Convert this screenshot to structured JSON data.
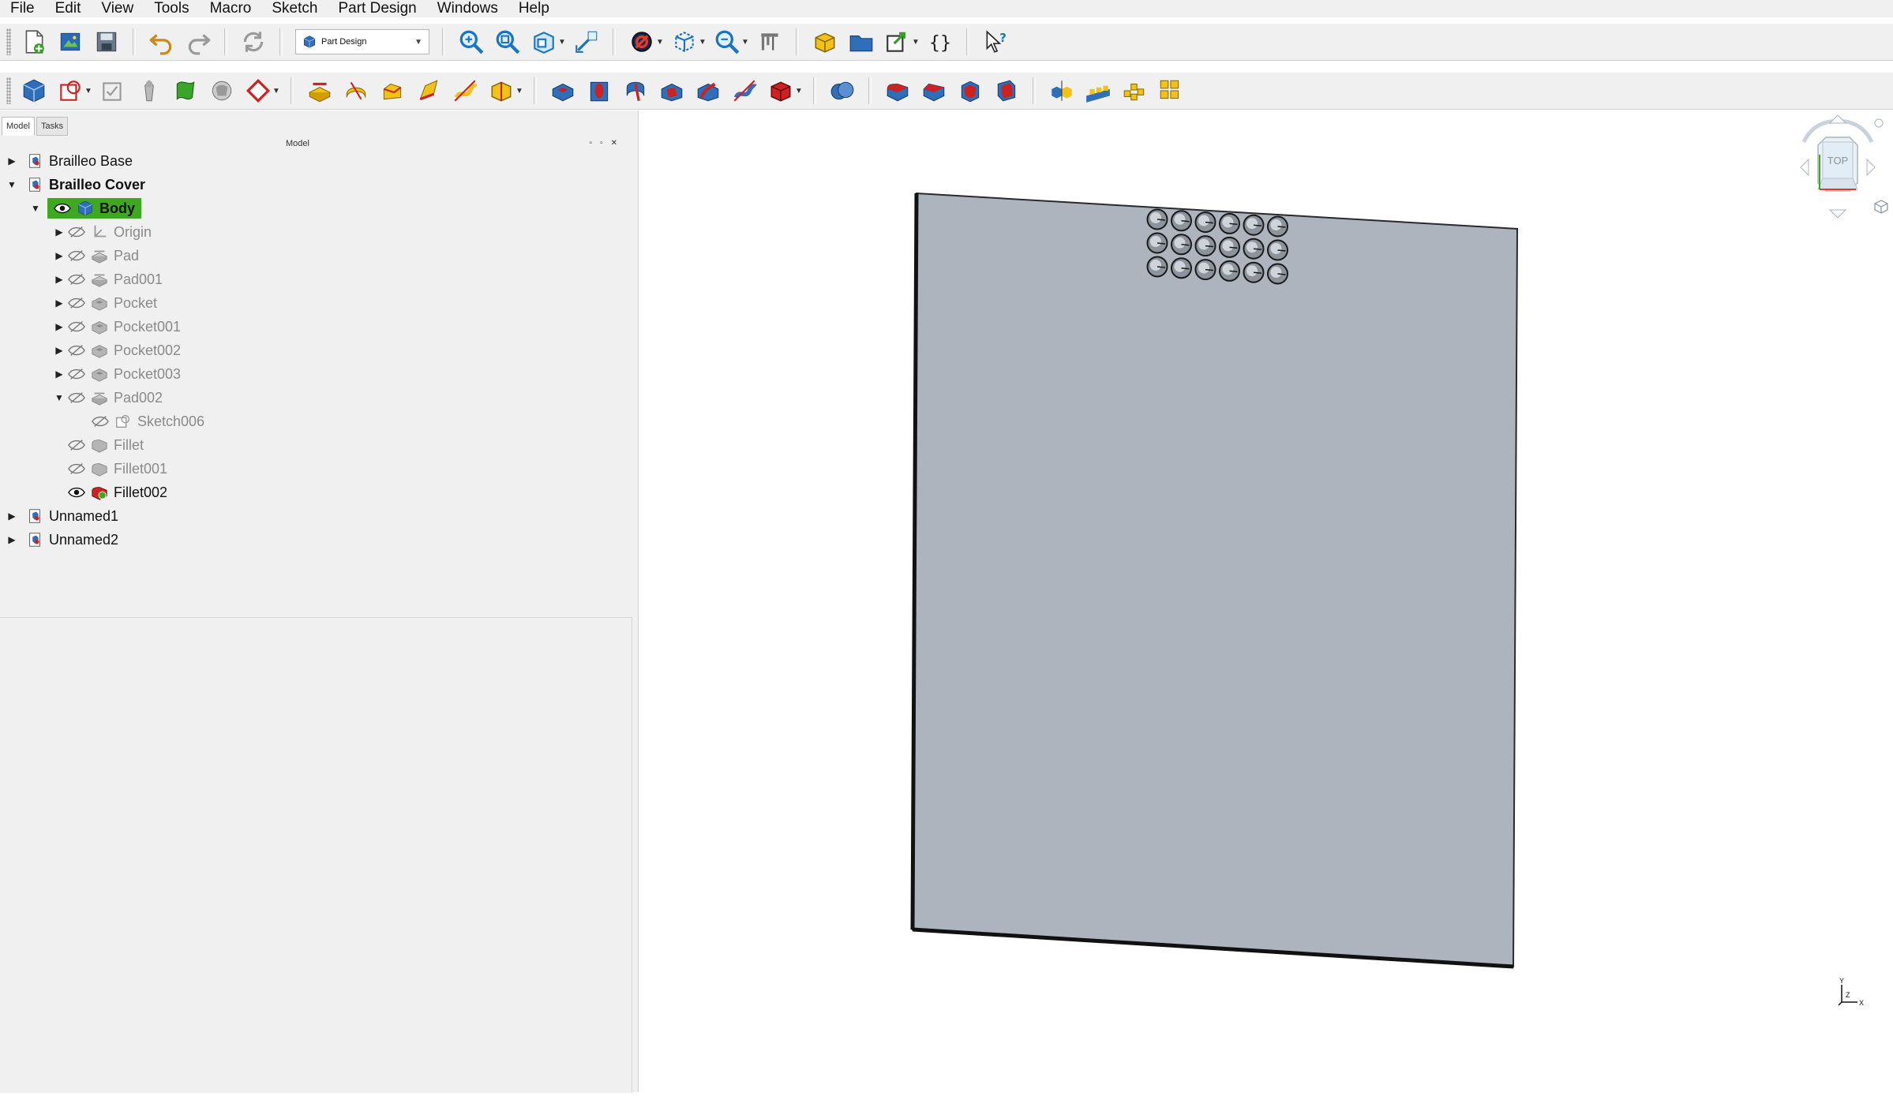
{
  "menu": [
    "File",
    "Edit",
    "View",
    "Tools",
    "Macro",
    "Sketch",
    "Part Design",
    "Windows",
    "Help"
  ],
  "workbench": {
    "label": "Part Design"
  },
  "tabs": [
    {
      "label": "Model"
    },
    {
      "label": "Tasks"
    }
  ],
  "model_panel": {
    "title": "Model"
  },
  "tree": [
    {
      "label": "Brailleo Base"
    },
    {
      "label": "Brailleo Cover"
    },
    {
      "label": "Body"
    },
    {
      "label": "Origin"
    },
    {
      "label": "Pad"
    },
    {
      "label": "Pad001"
    },
    {
      "label": "Pocket"
    },
    {
      "label": "Pocket001"
    },
    {
      "label": "Pocket002"
    },
    {
      "label": "Pocket003"
    },
    {
      "label": "Pad002"
    },
    {
      "label": "Sketch006"
    },
    {
      "label": "Fillet"
    },
    {
      "label": "Fillet001"
    },
    {
      "label": "Fillet002"
    },
    {
      "label": "Unnamed1"
    },
    {
      "label": "Unnamed2"
    }
  ],
  "navcube": {
    "face_label": "TOP"
  },
  "axis": {
    "x": "X",
    "y": "Y",
    "z": "Z"
  },
  "colors": {
    "selection_green": "#3ea822",
    "model_face": "#aeb4be",
    "panel_bg": "#f0f0f0"
  }
}
